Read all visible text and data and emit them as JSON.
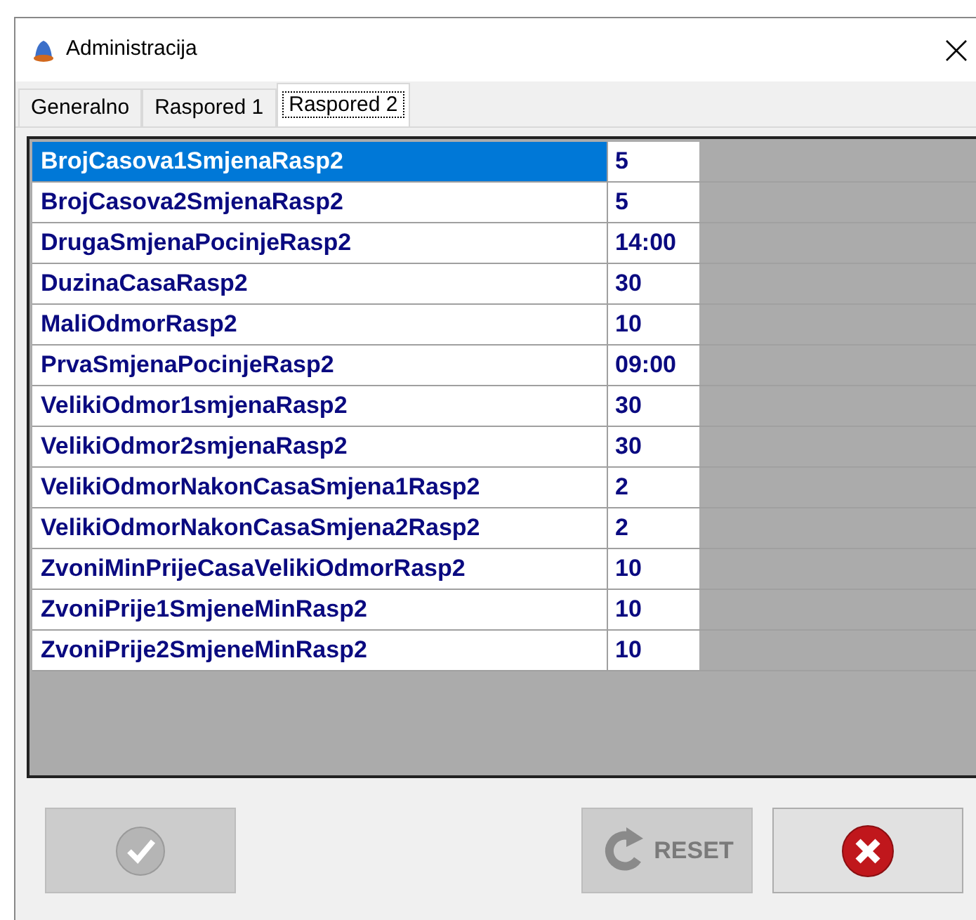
{
  "window": {
    "title": "Administracija"
  },
  "tabs": [
    {
      "label": "Generalno",
      "selected": false
    },
    {
      "label": "Raspored 1",
      "selected": false
    },
    {
      "label": "Raspored 2",
      "selected": true
    }
  ],
  "grid": {
    "rows": [
      {
        "name": "BrojCasova1SmjenaRasp2",
        "value": "5",
        "selected": true
      },
      {
        "name": "BrojCasova2SmjenaRasp2",
        "value": "5",
        "selected": false
      },
      {
        "name": "DrugaSmjenaPocinjeRasp2",
        "value": "14:00",
        "selected": false
      },
      {
        "name": "DuzinaCasaRasp2",
        "value": "30",
        "selected": false
      },
      {
        "name": "MaliOdmorRasp2",
        "value": "10",
        "selected": false
      },
      {
        "name": "PrvaSmjenaPocinjeRasp2",
        "value": "09:00",
        "selected": false
      },
      {
        "name": "VelikiOdmor1smjenaRasp2",
        "value": "30",
        "selected": false
      },
      {
        "name": "VelikiOdmor2smjenaRasp2",
        "value": "30",
        "selected": false
      },
      {
        "name": "VelikiOdmorNakonCasaSmjena1Rasp2",
        "value": "2",
        "selected": false
      },
      {
        "name": "VelikiOdmorNakonCasaSmjena2Rasp2",
        "value": "2",
        "selected": false
      },
      {
        "name": "ZvoniMinPrijeCasaVelikiOdmorRasp2",
        "value": "10",
        "selected": false
      },
      {
        "name": "ZvoniPrije1SmjeneMinRasp2",
        "value": "10",
        "selected": false
      },
      {
        "name": "ZvoniPrije2SmjeneMinRasp2",
        "value": "10",
        "selected": false
      }
    ]
  },
  "buttons": [
    {
      "kind": "confirm",
      "disabled": true
    },
    {
      "kind": "reset",
      "label": "RESET",
      "disabled": true
    },
    {
      "kind": "cancel",
      "disabled": false
    }
  ]
}
